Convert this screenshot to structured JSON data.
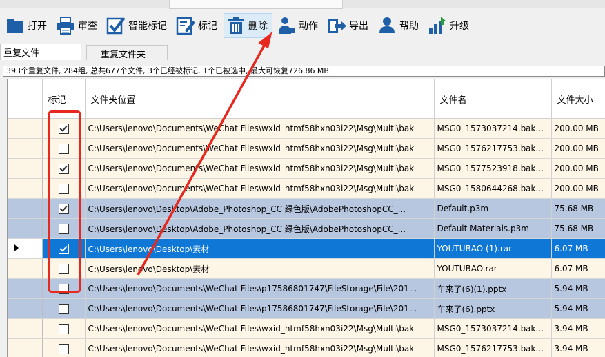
{
  "toolbar": {
    "buttons": [
      {
        "label": "打开",
        "icon": "folder-icon"
      },
      {
        "label": "审查",
        "icon": "printer-icon"
      },
      {
        "label": "智能标记",
        "icon": "checkmark-icon"
      },
      {
        "label": "标记",
        "icon": "edit-icon"
      },
      {
        "label": "删除",
        "icon": "trash-icon"
      },
      {
        "label": "动作",
        "icon": "user-action-icon"
      },
      {
        "label": "导出",
        "icon": "export-icon"
      },
      {
        "label": "帮助",
        "icon": "help-user-icon"
      },
      {
        "label": "升级",
        "icon": "upgrade-icon"
      }
    ]
  },
  "tabs": [
    "重复文件",
    "重复文件夹"
  ],
  "summary": "393个重复文件, 284组, 总共677个文件, 3个已经被标记, 1个已被选中, 最大可恢复726.86 MB",
  "columns": [
    "标记",
    "文件夹位置",
    "文件名",
    "文件大小"
  ],
  "rows": [
    {
      "checked": true,
      "path": "C:\\Users\\lenovo\\Documents\\WeChat Files\\wxid_htmf58hxn03i22\\Msg\\Multi\\bak",
      "name": "MSG0_1573037214.bak...",
      "size": "200.00 MB",
      "style": "cream"
    },
    {
      "checked": false,
      "path": "C:\\Users\\lenovo\\Documents\\WeChat Files\\wxid_htmf58hxn03i22\\Msg\\Multi\\bak",
      "name": "MSG0_1576217753.bak...",
      "size": "200.00 MB",
      "style": "cream"
    },
    {
      "checked": true,
      "path": "C:\\Users\\lenovo\\Documents\\WeChat Files\\wxid_htmf58hxn03i22\\Msg\\Multi\\bak",
      "name": "MSG0_1577523918.bak...",
      "size": "200.00 MB",
      "style": "cream"
    },
    {
      "checked": false,
      "path": "C:\\Users\\lenovo\\Documents\\WeChat Files\\wxid_htmf58hxn03i22\\Msg\\Multi\\bak",
      "name": "MSG0_1580644268.bak...",
      "size": "200.00 MB",
      "style": "cream"
    },
    {
      "checked": true,
      "path": "C:\\Users\\lenovo\\Desktop\\Adobe_Photoshop_CC 绿色版\\AdobePhotoshopCC_...",
      "name": "Default.p3m",
      "size": "75.68 MB",
      "style": "blue"
    },
    {
      "checked": false,
      "path": "C:\\Users\\lenovo\\Desktop\\Adobe_Photoshop_CC 绿色版\\AdobePhotoshopCC_...",
      "name": "Default Materials.p3m",
      "size": "75.68 MB",
      "style": "blue"
    },
    {
      "checked": true,
      "path": "C:\\Users\\lenovo\\Desktop\\素材",
      "name": "YOUTUBAO (1).rar",
      "size": "6.07 MB",
      "style": "sel"
    },
    {
      "checked": false,
      "path": "C:\\Users\\lenovo\\Desktop\\素材",
      "name": "YOUTUBAO.rar",
      "size": "6.07 MB",
      "style": "cream"
    },
    {
      "checked": false,
      "path": "C:\\Users\\lenovo\\Documents\\WeChat Files\\p17586801747\\FileStorage\\File\\201...",
      "name": "车来了(6)(1).pptx",
      "size": "5.94 MB",
      "style": "blue"
    },
    {
      "checked": false,
      "path": "C:\\Users\\lenovo\\Documents\\WeChat Files\\p17586801747\\FileStorage\\File\\201...",
      "name": "车来了(6).pptx",
      "size": "5.94 MB",
      "style": "blue"
    },
    {
      "checked": false,
      "path": "C:\\Users\\lenovo\\Documents\\WeChat Files\\wxid_htmf58hxn03i22\\Msg\\Multi\\bak",
      "name": "MSG0_1573037214.bak...",
      "size": "3.94 MB",
      "style": "cream"
    },
    {
      "checked": false,
      "path": "C:\\Users\\lenovo\\Documents\\WeChat Files\\wxid_htmf58hxn03i22\\Msg\\Multi\\bak",
      "name": "MSG0_1576217753.bak...",
      "size": "3.94 MB",
      "style": "cream"
    }
  ],
  "colors": {
    "accent": "#0f78d7",
    "annotation": "#e8281e",
    "group_a": "#fdf5e6",
    "group_b": "#b8c7e0"
  }
}
